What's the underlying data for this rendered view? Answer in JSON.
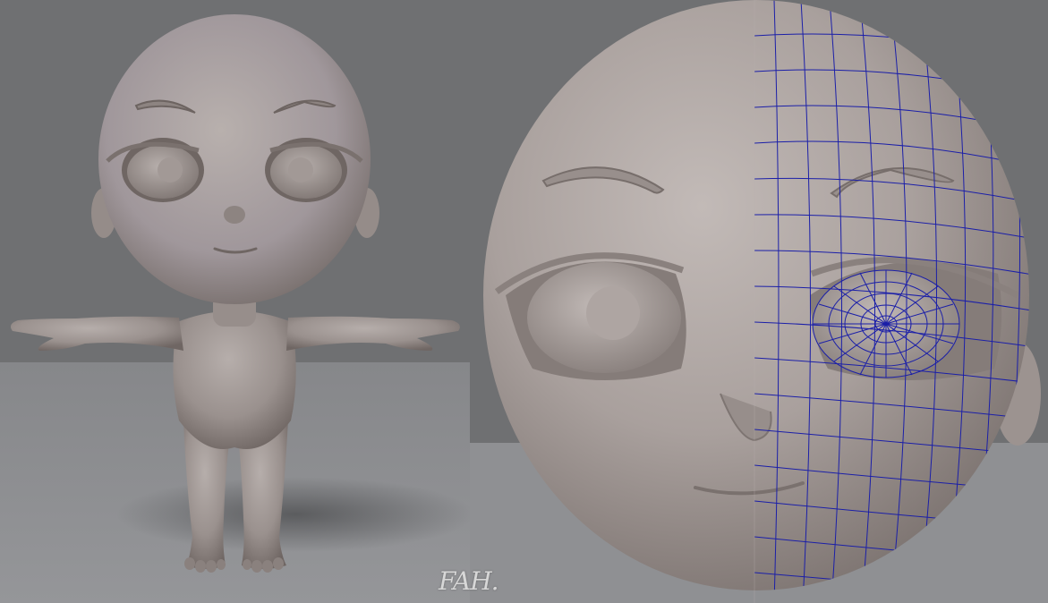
{
  "scene": {
    "left_view": "full-body-tpose",
    "right_view": "head-closeup-half-wireframe",
    "colors": {
      "background_top": "#6e6f71",
      "floor": "#8d8e90",
      "skin": "#a69d9a",
      "skin_highlight": "#c4bdba",
      "skin_shadow": "#6f6663",
      "wireframe": "#1b1fa8"
    }
  },
  "watermark": {
    "text": "FAH",
    "logo_text": "FAH."
  }
}
